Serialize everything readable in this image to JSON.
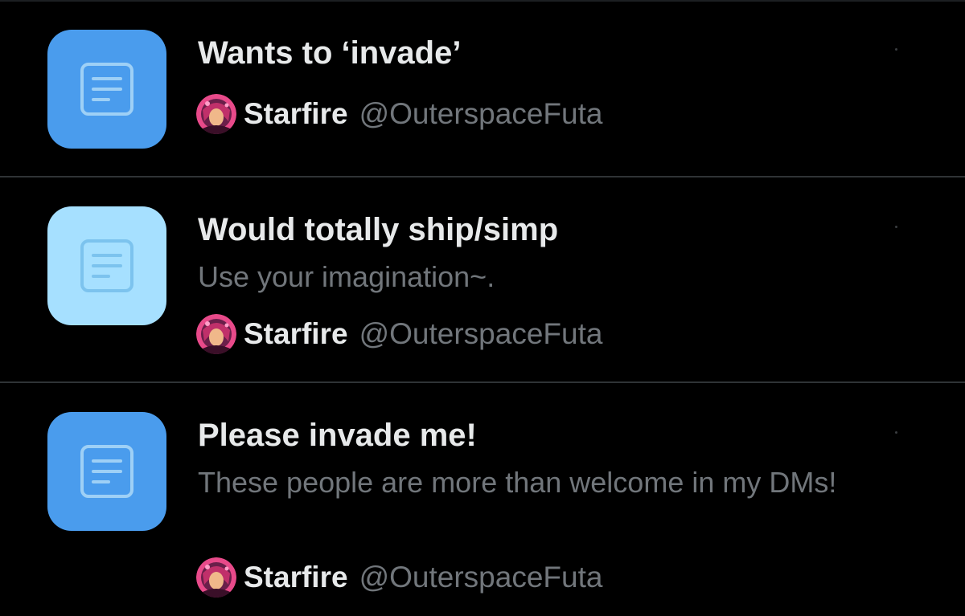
{
  "colors": {
    "background": "#000000",
    "divider": "#2f3336",
    "primary_text": "#e7e9ea",
    "secondary_text": "#71767b",
    "list_icon_blue": "#4a9ced",
    "list_icon_light_blue": "#a6e0ff"
  },
  "lists": [
    {
      "title": "Wants to ‘invade’",
      "description": "",
      "icon": "list-document-icon",
      "icon_color": "#4a9ced",
      "owner": {
        "name": "Starfire",
        "handle": "@OuterspaceFuta",
        "avatar": "starfire-avatar"
      }
    },
    {
      "title": "Would totally ship/simp",
      "description": "Use your imagination~.",
      "icon": "list-document-icon",
      "icon_color": "#a6e0ff",
      "owner": {
        "name": "Starfire",
        "handle": "@OuterspaceFuta",
        "avatar": "starfire-avatar"
      }
    },
    {
      "title": "Please invade me!",
      "description": "These people are more than welcome in my DMs!",
      "icon": "list-document-icon",
      "icon_color": "#4a9ced",
      "owner": {
        "name": "Starfire",
        "handle": "@OuterspaceFuta",
        "avatar": "starfire-avatar"
      }
    }
  ]
}
